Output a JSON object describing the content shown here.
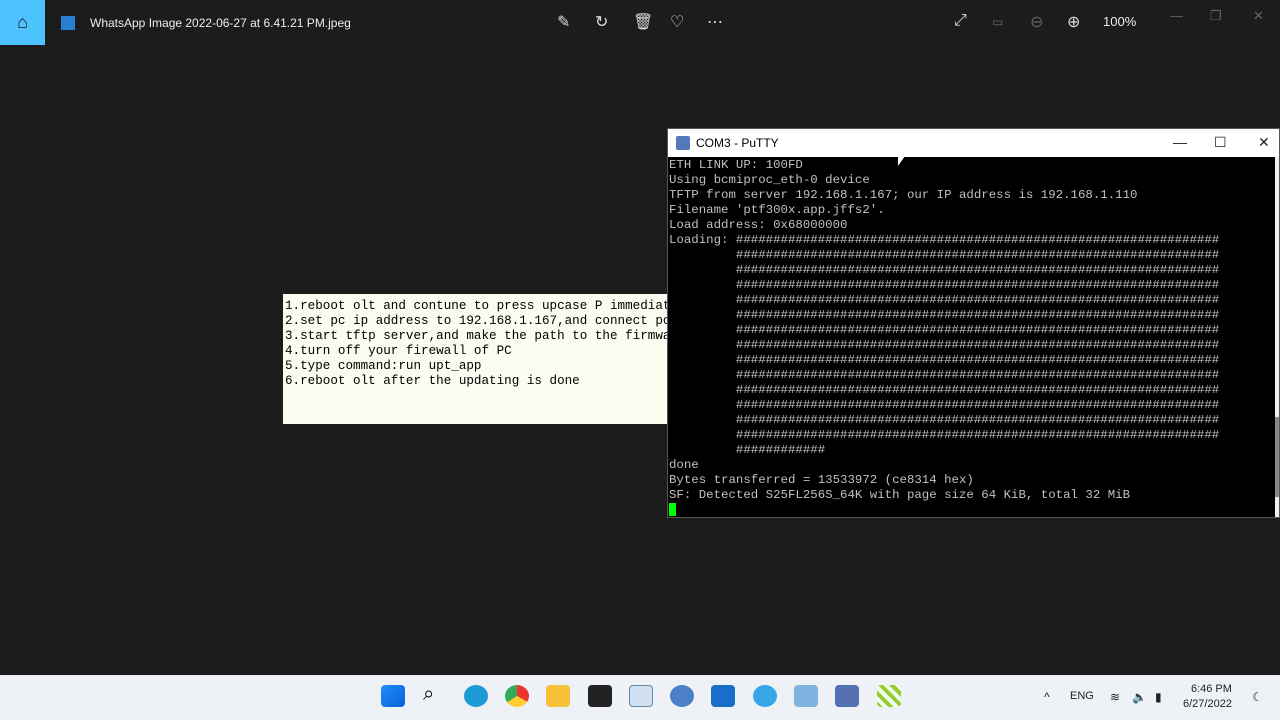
{
  "viewer": {
    "file_name": "WhatsApp Image 2022-06-27 at 6.41.21 PM.jpeg",
    "zoom": "100%"
  },
  "note_lines": [
    "1.reboot olt and contune to press upcase P immediat",
    "2.set pc ip address to 192.168.1.167,and connect pc",
    "3.start tftp server,and make the path to the firmwa",
    "4.turn off your firewall of PC",
    "5.type command:run upt_app",
    "6.reboot olt after the updating is done"
  ],
  "putty": {
    "title": "COM3 - PuTTY",
    "lines": [
      "ETH LINK UP: 100FD",
      "Using bcmiproc_eth-0 device",
      "TFTP from server 192.168.1.167; our IP address is 192.168.1.110",
      "Filename 'ptf300x.app.jffs2'.",
      "Load address: 0x68000000",
      "Loading: #################################################################",
      "         #################################################################",
      "         #################################################################",
      "         #################################################################",
      "         #################################################################",
      "         #################################################################",
      "         #################################################################",
      "         #################################################################",
      "         #################################################################",
      "         #################################################################",
      "         #################################################################",
      "         #################################################################",
      "         #################################################################",
      "         #################################################################",
      "         ############",
      "done",
      "Bytes transferred = 13533972 (ce8314 hex)",
      "SF: Detected S25FL256S_64K with page size 64 KiB, total 32 MiB"
    ]
  },
  "taskbar": {
    "lang": "ENG",
    "time": "6:46 PM",
    "date": "6/27/2022"
  }
}
